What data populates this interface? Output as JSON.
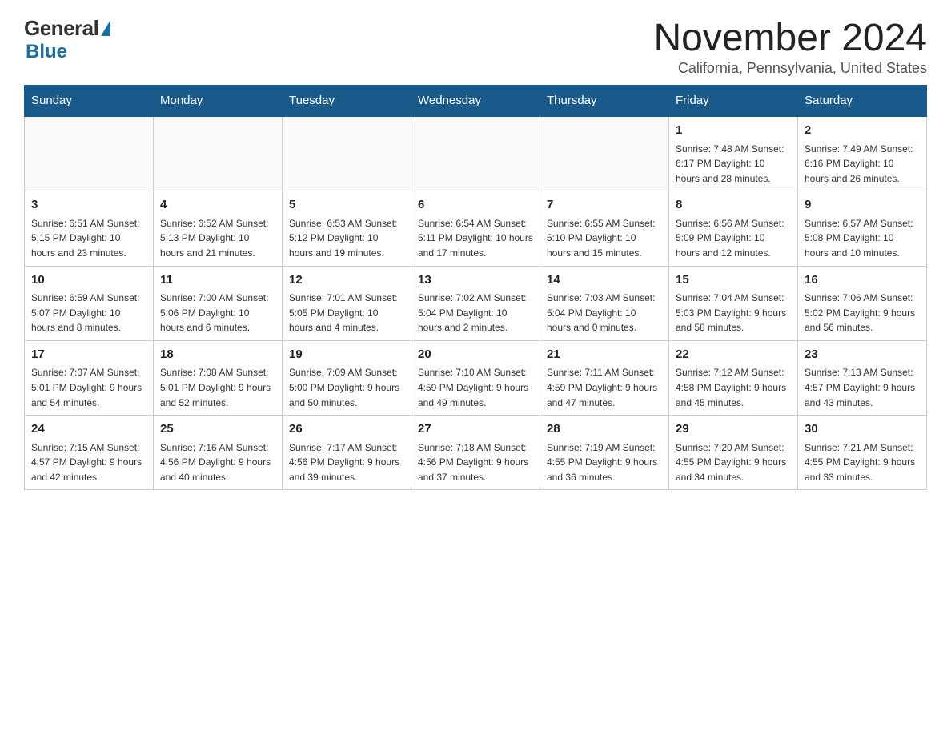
{
  "header": {
    "logo_general": "General",
    "logo_blue": "Blue",
    "month_title": "November 2024",
    "location": "California, Pennsylvania, United States"
  },
  "weekdays": [
    "Sunday",
    "Monday",
    "Tuesday",
    "Wednesday",
    "Thursday",
    "Friday",
    "Saturday"
  ],
  "weeks": [
    {
      "days": [
        {
          "num": "",
          "info": ""
        },
        {
          "num": "",
          "info": ""
        },
        {
          "num": "",
          "info": ""
        },
        {
          "num": "",
          "info": ""
        },
        {
          "num": "",
          "info": ""
        },
        {
          "num": "1",
          "info": "Sunrise: 7:48 AM\nSunset: 6:17 PM\nDaylight: 10 hours and 28 minutes."
        },
        {
          "num": "2",
          "info": "Sunrise: 7:49 AM\nSunset: 6:16 PM\nDaylight: 10 hours and 26 minutes."
        }
      ]
    },
    {
      "days": [
        {
          "num": "3",
          "info": "Sunrise: 6:51 AM\nSunset: 5:15 PM\nDaylight: 10 hours and 23 minutes."
        },
        {
          "num": "4",
          "info": "Sunrise: 6:52 AM\nSunset: 5:13 PM\nDaylight: 10 hours and 21 minutes."
        },
        {
          "num": "5",
          "info": "Sunrise: 6:53 AM\nSunset: 5:12 PM\nDaylight: 10 hours and 19 minutes."
        },
        {
          "num": "6",
          "info": "Sunrise: 6:54 AM\nSunset: 5:11 PM\nDaylight: 10 hours and 17 minutes."
        },
        {
          "num": "7",
          "info": "Sunrise: 6:55 AM\nSunset: 5:10 PM\nDaylight: 10 hours and 15 minutes."
        },
        {
          "num": "8",
          "info": "Sunrise: 6:56 AM\nSunset: 5:09 PM\nDaylight: 10 hours and 12 minutes."
        },
        {
          "num": "9",
          "info": "Sunrise: 6:57 AM\nSunset: 5:08 PM\nDaylight: 10 hours and 10 minutes."
        }
      ]
    },
    {
      "days": [
        {
          "num": "10",
          "info": "Sunrise: 6:59 AM\nSunset: 5:07 PM\nDaylight: 10 hours and 8 minutes."
        },
        {
          "num": "11",
          "info": "Sunrise: 7:00 AM\nSunset: 5:06 PM\nDaylight: 10 hours and 6 minutes."
        },
        {
          "num": "12",
          "info": "Sunrise: 7:01 AM\nSunset: 5:05 PM\nDaylight: 10 hours and 4 minutes."
        },
        {
          "num": "13",
          "info": "Sunrise: 7:02 AM\nSunset: 5:04 PM\nDaylight: 10 hours and 2 minutes."
        },
        {
          "num": "14",
          "info": "Sunrise: 7:03 AM\nSunset: 5:04 PM\nDaylight: 10 hours and 0 minutes."
        },
        {
          "num": "15",
          "info": "Sunrise: 7:04 AM\nSunset: 5:03 PM\nDaylight: 9 hours and 58 minutes."
        },
        {
          "num": "16",
          "info": "Sunrise: 7:06 AM\nSunset: 5:02 PM\nDaylight: 9 hours and 56 minutes."
        }
      ]
    },
    {
      "days": [
        {
          "num": "17",
          "info": "Sunrise: 7:07 AM\nSunset: 5:01 PM\nDaylight: 9 hours and 54 minutes."
        },
        {
          "num": "18",
          "info": "Sunrise: 7:08 AM\nSunset: 5:01 PM\nDaylight: 9 hours and 52 minutes."
        },
        {
          "num": "19",
          "info": "Sunrise: 7:09 AM\nSunset: 5:00 PM\nDaylight: 9 hours and 50 minutes."
        },
        {
          "num": "20",
          "info": "Sunrise: 7:10 AM\nSunset: 4:59 PM\nDaylight: 9 hours and 49 minutes."
        },
        {
          "num": "21",
          "info": "Sunrise: 7:11 AM\nSunset: 4:59 PM\nDaylight: 9 hours and 47 minutes."
        },
        {
          "num": "22",
          "info": "Sunrise: 7:12 AM\nSunset: 4:58 PM\nDaylight: 9 hours and 45 minutes."
        },
        {
          "num": "23",
          "info": "Sunrise: 7:13 AM\nSunset: 4:57 PM\nDaylight: 9 hours and 43 minutes."
        }
      ]
    },
    {
      "days": [
        {
          "num": "24",
          "info": "Sunrise: 7:15 AM\nSunset: 4:57 PM\nDaylight: 9 hours and 42 minutes."
        },
        {
          "num": "25",
          "info": "Sunrise: 7:16 AM\nSunset: 4:56 PM\nDaylight: 9 hours and 40 minutes."
        },
        {
          "num": "26",
          "info": "Sunrise: 7:17 AM\nSunset: 4:56 PM\nDaylight: 9 hours and 39 minutes."
        },
        {
          "num": "27",
          "info": "Sunrise: 7:18 AM\nSunset: 4:56 PM\nDaylight: 9 hours and 37 minutes."
        },
        {
          "num": "28",
          "info": "Sunrise: 7:19 AM\nSunset: 4:55 PM\nDaylight: 9 hours and 36 minutes."
        },
        {
          "num": "29",
          "info": "Sunrise: 7:20 AM\nSunset: 4:55 PM\nDaylight: 9 hours and 34 minutes."
        },
        {
          "num": "30",
          "info": "Sunrise: 7:21 AM\nSunset: 4:55 PM\nDaylight: 9 hours and 33 minutes."
        }
      ]
    }
  ]
}
